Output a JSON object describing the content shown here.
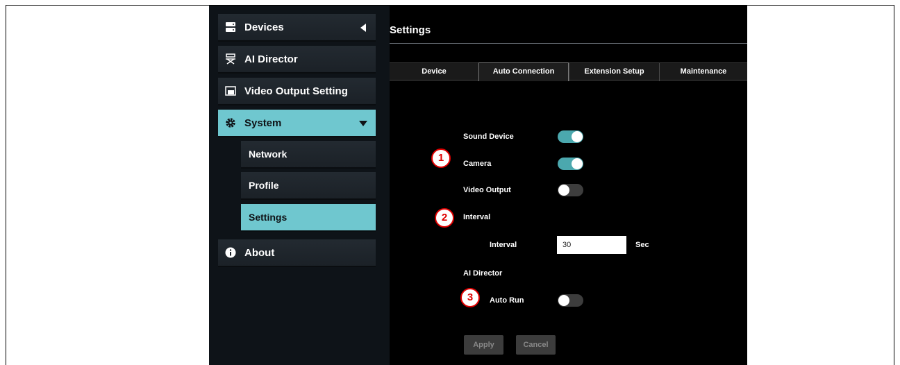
{
  "sidebar": {
    "items": [
      {
        "label": "Devices",
        "icon": "server-icon"
      },
      {
        "label": "AI Director",
        "icon": "director-chair-icon"
      },
      {
        "label": "Video Output Setting",
        "icon": "video-output-icon"
      },
      {
        "label": "System",
        "icon": "gear-icon"
      },
      {
        "label": "About",
        "icon": "info-icon"
      }
    ],
    "sub_items": [
      {
        "label": "Network"
      },
      {
        "label": "Profile"
      },
      {
        "label": "Settings"
      }
    ]
  },
  "main": {
    "title": "Settings",
    "tabs": [
      {
        "label": "Device"
      },
      {
        "label": "Auto Connection"
      },
      {
        "label": "Extension Setup"
      },
      {
        "label": "Maintenance"
      }
    ],
    "settings": {
      "sound_device": {
        "label": "Sound Device",
        "on": true
      },
      "camera": {
        "label": "Camera",
        "on": true
      },
      "video_output": {
        "label": "Video Output",
        "on": false
      },
      "interval_section": "Interval",
      "interval": {
        "label": "Interval",
        "value": "30",
        "unit": "Sec"
      },
      "ai_director_section": "AI Director",
      "auto_run": {
        "label": "Auto Run",
        "on": false
      }
    },
    "buttons": {
      "apply": "Apply",
      "cancel": "Cancel"
    }
  },
  "markers": [
    "1",
    "2",
    "3"
  ],
  "colors": {
    "accent": "#6fc7cf",
    "toggle_on": "#4ba8ae",
    "marker": "#e00000"
  }
}
